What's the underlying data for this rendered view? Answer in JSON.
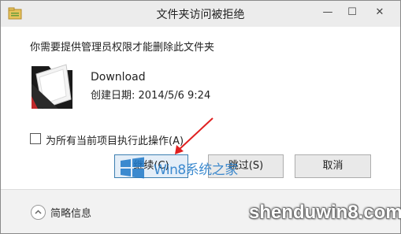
{
  "window": {
    "title": "文件夹访问被拒绝",
    "controls": {
      "minimize": "—",
      "maximize": "☐",
      "close": "✕"
    }
  },
  "dialog": {
    "message": "你需要提供管理员权限才能删除此文件夹",
    "folder_name": "Download",
    "created": "创建日期: 2014/5/6 9:24",
    "apply_all_label": "为所有当前项目执行此操作(A)",
    "apply_all_checked": false
  },
  "buttons": {
    "continue": "继续(C)",
    "skip": "跳过(S)",
    "cancel": "取消"
  },
  "footer": {
    "details_label": "简略信息",
    "details_icon": "chevron-up-icon"
  },
  "watermarks": {
    "overlay_text": "Win8系统之家",
    "site_text": "shenduwin8.com"
  },
  "colors": {
    "annotation_arrow": "#e02020",
    "watermark_blue": "#1e78c8"
  }
}
